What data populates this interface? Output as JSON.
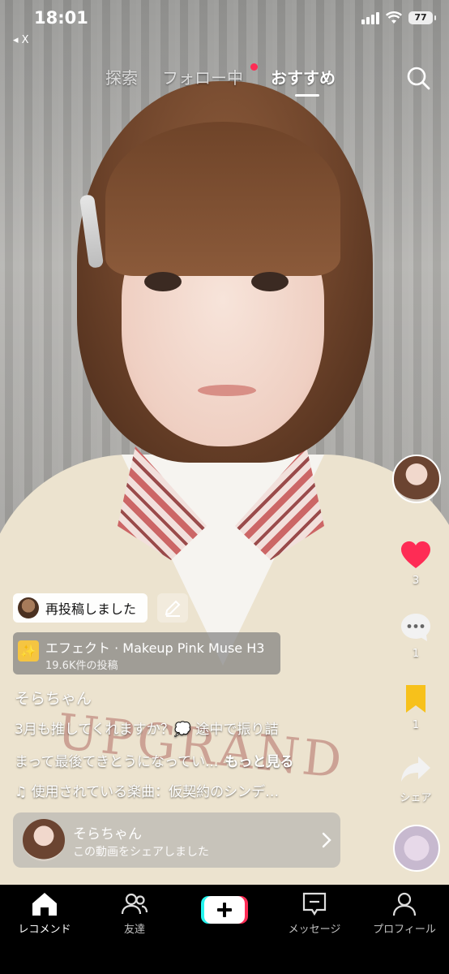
{
  "status_bar": {
    "time": "18:01",
    "back_app": "◂ X",
    "battery": "77"
  },
  "top_tabs": {
    "explore": "探索",
    "following": "フォロー中",
    "recommended": "おすすめ"
  },
  "right_rail": {
    "like_count": "3",
    "comment_count": "1",
    "bookmark_count": "1",
    "share_label": "シェア"
  },
  "repost": {
    "label": "再投稿しました"
  },
  "effect": {
    "name": "エフェクト · Makeup Pink Muse H3",
    "count": "19.6K件の投稿"
  },
  "post": {
    "username": "そらちゃん",
    "caption_line1": "3月も推してくれますか？💭 途中で振り詰",
    "caption_line2": "まって最後てきとうになってい...",
    "more_label": "もっと見る",
    "music": "♫ 使用されている楽曲：仮契約のシンデ…"
  },
  "share_card": {
    "name": "そらちゃん",
    "text": "この動画をシェアしました"
  },
  "video_overlay_text": "UPGRAND",
  "bottom_nav": {
    "home": "レコメンド",
    "friends": "友達",
    "inbox": "メッセージ",
    "profile": "プロフィール"
  },
  "colors": {
    "like_red": "#fe2c55",
    "bookmark_yellow": "#f7c11b",
    "create_cyan": "#25f4ee",
    "create_red": "#fe2c55"
  },
  "icons": [
    "search-icon",
    "heart-icon",
    "comment-icon",
    "bookmark-icon",
    "share-icon",
    "edit-icon",
    "effect-icon",
    "chevron-right-icon",
    "home-icon",
    "friends-icon",
    "plus-icon",
    "inbox-icon",
    "profile-icon"
  ]
}
